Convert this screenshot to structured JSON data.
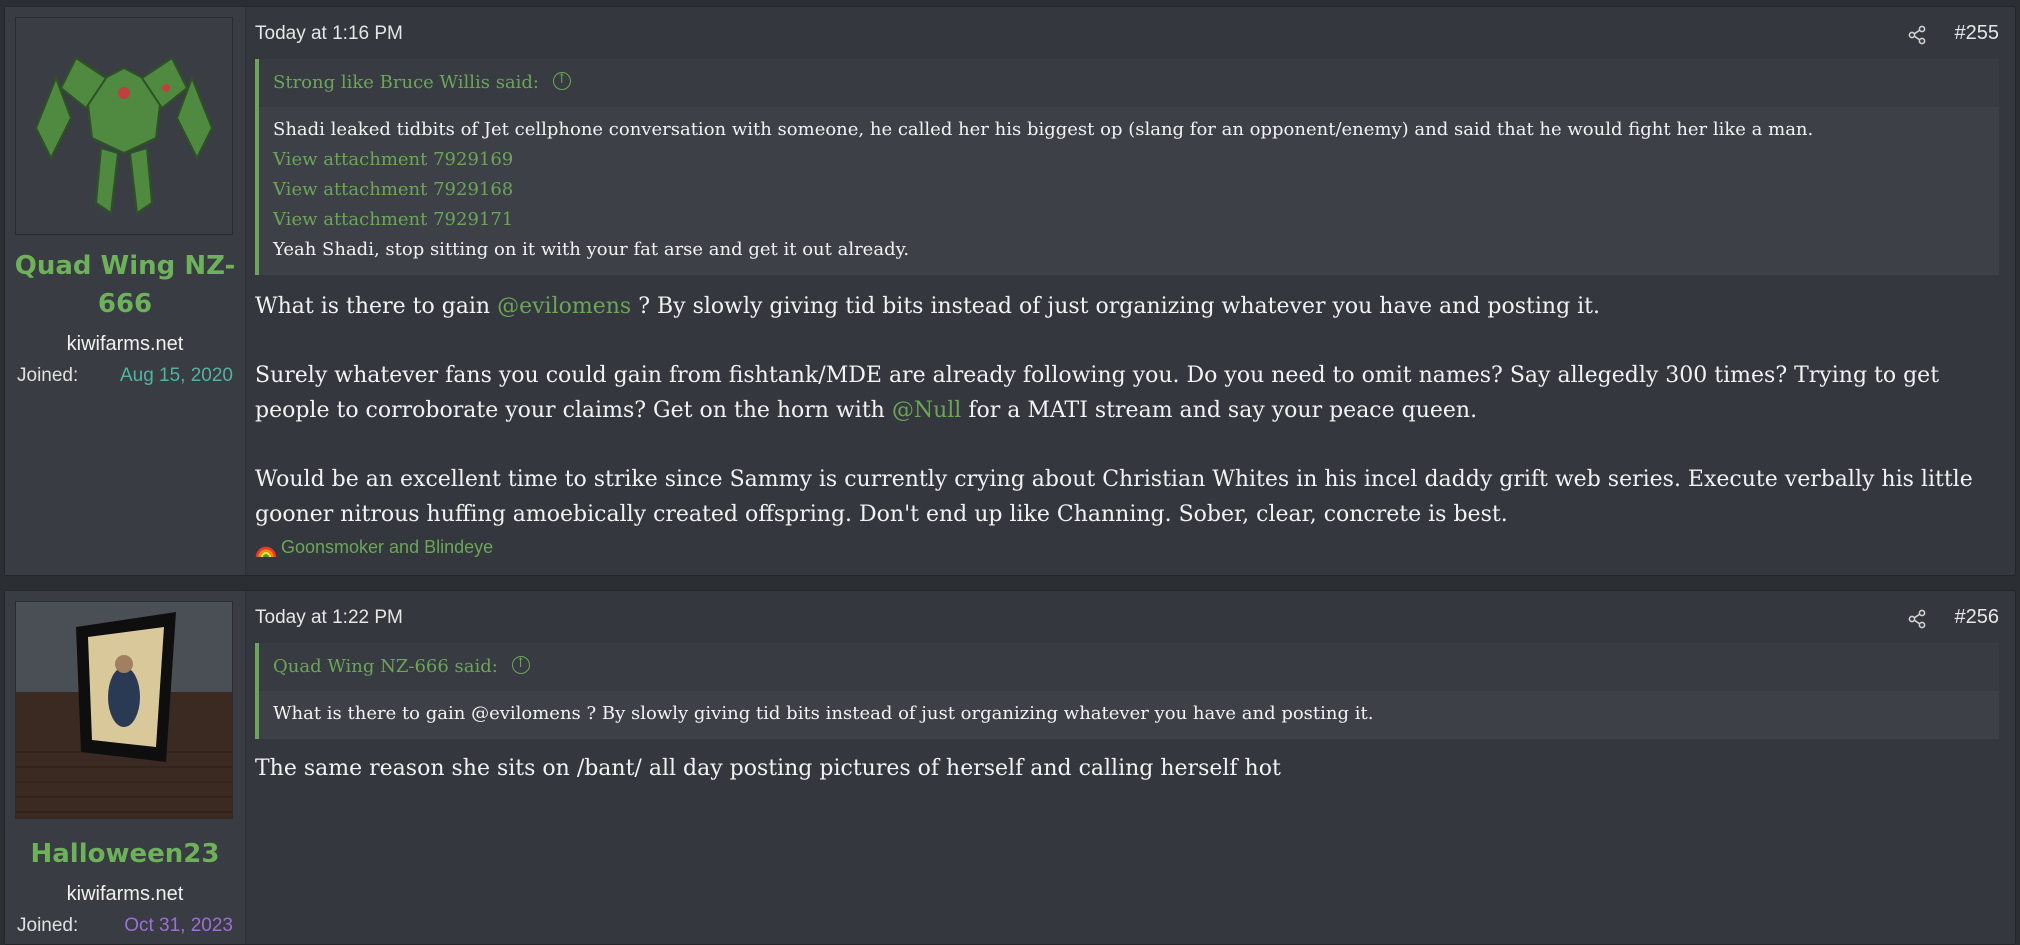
{
  "posts": [
    {
      "username": "Quad Wing NZ-666",
      "site": "kiwifarms.net",
      "joined_label": "Joined:",
      "joined_date": "Aug 15, 2020",
      "joined_color": "#52b3a3",
      "date": "Today at 1:16 PM",
      "number": "#255",
      "quote": {
        "author": "Strong like Bruce Willis said:",
        "text": "Shadi leaked tidbits of Jet cellphone conversation with someone, he called her his biggest op (slang for an opponent/enemy) and said that he would fight her like a man.",
        "attachments": [
          "View attachment 7929169",
          "View attachment 7929168",
          "View attachment 7929171"
        ],
        "closing": "Yeah Shadi, stop sitting on it with your fat arse and get it out already."
      },
      "message": {
        "p1_a": "What is there to gain ",
        "p1_mention": "@evilomens",
        "p1_b": " ? By slowly giving tid bits instead of just organizing whatever you have and posting it.",
        "p2_a": "Surely whatever fans you could gain from fishtank/MDE are already following you. Do you need to omit names? Say allegedly 300 times? Trying to get people to corroborate your claims? Get on the horn with ",
        "p2_mention": "@Null",
        "p2_b": " for a MATI stream and say your peace queen.",
        "p3": "Would be an excellent time to strike since Sammy is currently crying about Christian Whites in his incel daddy grift web series. Execute verbally his little gooner nitrous huffing amoebically created offspring. Don't end up like Channing. Sober, clear, concrete is best."
      },
      "reactions": "Goonsmoker and Blindeye"
    },
    {
      "username": "Halloween23",
      "site": "kiwifarms.net",
      "joined_label": "Joined:",
      "joined_date": "Oct 31, 2023",
      "joined_color": "#9b6fd6",
      "date": "Today at 1:22 PM",
      "number": "#256",
      "quote": {
        "author": "Quad Wing NZ-666 said:",
        "text": "What is there to gain @evilomens ? By slowly giving tid bits instead of just organizing whatever you have and posting it."
      },
      "message": {
        "p1": "The same reason she sits on /bant/ all day posting pictures of herself and calling herself hot"
      }
    }
  ],
  "colors": {
    "accent": "#6ba658",
    "background": "#34373d"
  },
  "icons": {
    "share": "share-icon",
    "quote_jump": "arrow-up-circle-icon",
    "reaction": "rainbow-icon"
  }
}
